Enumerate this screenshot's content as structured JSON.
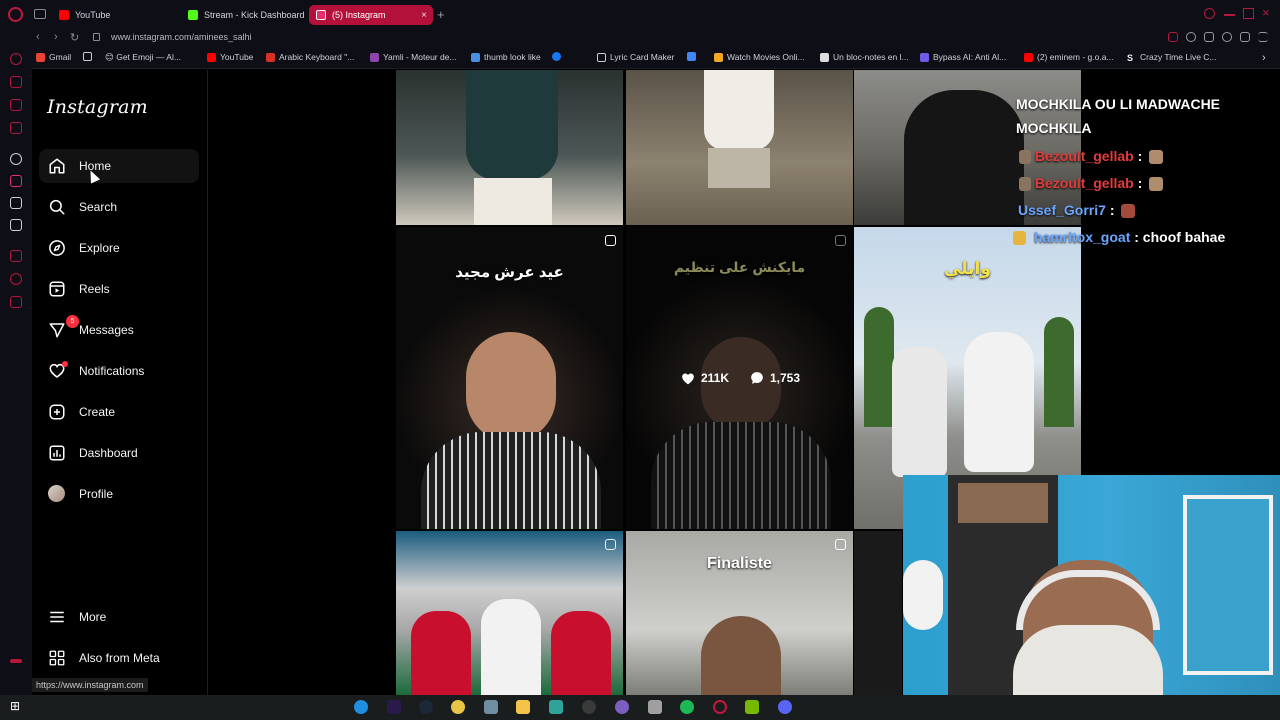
{
  "browser": {
    "tabs": [
      {
        "title": "YouTube",
        "color": "#ff0000",
        "active": false
      },
      {
        "title": "Stream - Kick Dashboard",
        "color": "#53fc18",
        "active": false
      },
      {
        "title": "(5) Instagram",
        "color": "#e1306c",
        "active": true
      }
    ],
    "tab_close": "×",
    "new_tab": "+",
    "back": "‹",
    "forward": "›",
    "reload": "↻",
    "url": "www.instagram.com/aminees_salhi",
    "bookmarks": [
      {
        "label": "Gmail",
        "color": "#ea4335"
      },
      {
        "label": "",
        "color": "#cccccc"
      },
      {
        "label": "😊 Get Emoji — Al...",
        "color": "#f0c040"
      },
      {
        "label": "YouTube",
        "color": "#ff0000"
      },
      {
        "label": "Arabic Keyboard \"...",
        "color": "#d93025"
      },
      {
        "label": "Yamli - Moteur de...",
        "color": "#8e44ad"
      },
      {
        "label": "thumb look like",
        "color": "#4a90e2"
      },
      {
        "label": "",
        "color": "#1877f2"
      },
      {
        "label": "Lyric Card Maker",
        "color": "#cccccc"
      },
      {
        "label": "",
        "color": "#4285f4"
      },
      {
        "label": "Watch Movies Onli...",
        "color": "#f5a623"
      },
      {
        "label": "Un bloc-notes en l...",
        "color": "#dddddd"
      },
      {
        "label": "Bypass AI: Anti Al...",
        "color": "#6c5ce7"
      },
      {
        "label": "(2) eminem - g.o.a...",
        "color": "#ff0000"
      },
      {
        "label": "Crazy Time Live C...",
        "color": "#eeeeee"
      }
    ],
    "status_url": "https://www.instagram.com"
  },
  "instagram": {
    "logo": "Instagram",
    "nav": [
      {
        "id": "home",
        "label": "Home",
        "icon": "home-icon"
      },
      {
        "id": "search",
        "label": "Search",
        "icon": "search-icon"
      },
      {
        "id": "explore",
        "label": "Explore",
        "icon": "compass-icon"
      },
      {
        "id": "reels",
        "label": "Reels",
        "icon": "reels-icon"
      },
      {
        "id": "messages",
        "label": "Messages",
        "icon": "messenger-icon",
        "badge": "5"
      },
      {
        "id": "notifications",
        "label": "Notifications",
        "icon": "heart-icon"
      },
      {
        "id": "create",
        "label": "Create",
        "icon": "plus-square-icon"
      },
      {
        "id": "dashboard",
        "label": "Dashboard",
        "icon": "dashboard-icon"
      },
      {
        "id": "profile",
        "label": "Profile",
        "icon": "avatar"
      }
    ],
    "more": "More",
    "also_from_meta": "Also from Meta",
    "grid": {
      "captions": {
        "tile4": "عيد عرش مجيد",
        "tile5": "مايكنش على تنظيم",
        "tile6": "وايلي",
        "tile8": "Finaliste"
      },
      "hover_stats": {
        "likes": "211K",
        "comments": "1,753"
      }
    }
  },
  "chat": [
    {
      "user": "",
      "message": "MOCHKILA OU LI MADWACHE",
      "user_color": "#ffffff"
    },
    {
      "user": "",
      "message": "MOCHKILA",
      "user_color": "#ffffff"
    },
    {
      "user": "Bezoult_gellab",
      "message": ":",
      "user_color": "#e23b3b"
    },
    {
      "user": "Bezoult_gellab",
      "message": ":",
      "user_color": "#e23b3b"
    },
    {
      "user": "Ussef_Gorri7",
      "message": ":",
      "user_color": "#6aa6ff"
    },
    {
      "user": "hamritox_goat",
      "message": ": choof bahae",
      "user_color": "#6aa6ff"
    }
  ]
}
